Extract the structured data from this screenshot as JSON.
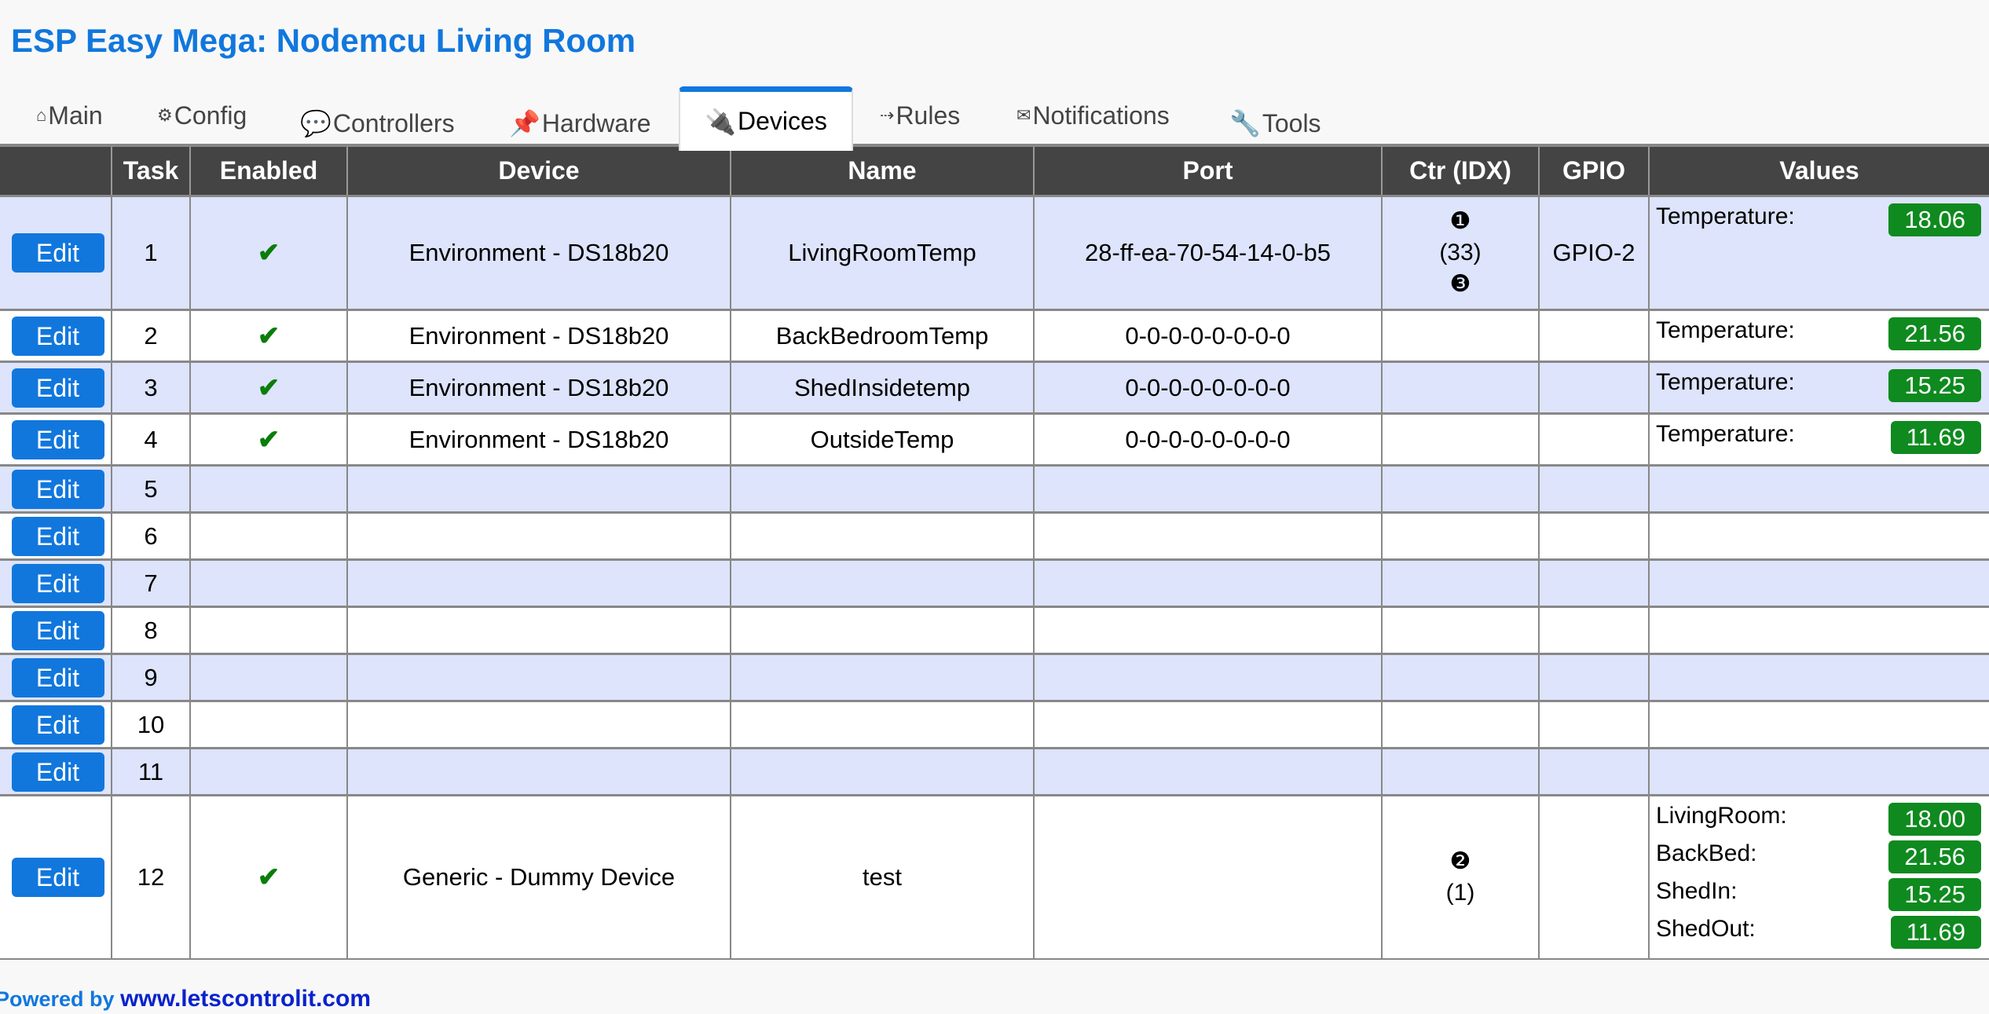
{
  "page_title": "ESP Easy Mega: Nodemcu Living Room",
  "tabs": [
    {
      "label": "Main",
      "icon": "⌂",
      "icon_name": "home-icon",
      "active": false
    },
    {
      "label": "Config",
      "icon": "⚙",
      "icon_name": "gear-icon",
      "active": false
    },
    {
      "label": "Controllers",
      "icon": "💬",
      "icon_name": "speech-bubble-icon",
      "active": false
    },
    {
      "label": "Hardware",
      "icon": "📌",
      "icon_name": "pushpin-icon",
      "active": false
    },
    {
      "label": "Devices",
      "icon": "🔌",
      "icon_name": "plug-icon",
      "active": true
    },
    {
      "label": "Rules",
      "icon": "⇢",
      "icon_name": "arrow-right-icon",
      "active": false
    },
    {
      "label": "Notifications",
      "icon": "✉",
      "icon_name": "envelope-icon",
      "active": false
    },
    {
      "label": "Tools",
      "icon": "🔧",
      "icon_name": "wrench-icon",
      "active": false
    }
  ],
  "table": {
    "headers": [
      "",
      "Task",
      "Enabled",
      "Device",
      "Name",
      "Port",
      "Ctr (IDX)",
      "GPIO",
      "Values"
    ],
    "edit_label": "Edit",
    "enabled_mark": "✔",
    "rows": [
      {
        "task": "1",
        "enabled": true,
        "device": "Environment - DS18b20",
        "name": "LivingRoomTemp",
        "port": "28-ff-ea-70-54-14-0-b5",
        "ctr": [
          "❶",
          "(33)",
          "❸"
        ],
        "gpio": "GPIO-2",
        "values": [
          {
            "label": "Temperature:",
            "value": "18.06"
          }
        ]
      },
      {
        "task": "2",
        "enabled": true,
        "device": "Environment - DS18b20",
        "name": "BackBedroomTemp",
        "port": "0-0-0-0-0-0-0-0",
        "ctr": [],
        "gpio": "",
        "values": [
          {
            "label": "Temperature:",
            "value": "21.56"
          }
        ]
      },
      {
        "task": "3",
        "enabled": true,
        "device": "Environment - DS18b20",
        "name": "ShedInsidetemp",
        "port": "0-0-0-0-0-0-0-0",
        "ctr": [],
        "gpio": "",
        "values": [
          {
            "label": "Temperature:",
            "value": "15.25"
          }
        ]
      },
      {
        "task": "4",
        "enabled": true,
        "device": "Environment - DS18b20",
        "name": "OutsideTemp",
        "port": "0-0-0-0-0-0-0-0",
        "ctr": [],
        "gpio": "",
        "values": [
          {
            "label": "Temperature:",
            "value": "11.69"
          }
        ]
      },
      {
        "task": "5",
        "enabled": false,
        "device": "",
        "name": "",
        "port": "",
        "ctr": [],
        "gpio": "",
        "values": []
      },
      {
        "task": "6",
        "enabled": false,
        "device": "",
        "name": "",
        "port": "",
        "ctr": [],
        "gpio": "",
        "values": []
      },
      {
        "task": "7",
        "enabled": false,
        "device": "",
        "name": "",
        "port": "",
        "ctr": [],
        "gpio": "",
        "values": []
      },
      {
        "task": "8",
        "enabled": false,
        "device": "",
        "name": "",
        "port": "",
        "ctr": [],
        "gpio": "",
        "values": []
      },
      {
        "task": "9",
        "enabled": false,
        "device": "",
        "name": "",
        "port": "",
        "ctr": [],
        "gpio": "",
        "values": []
      },
      {
        "task": "10",
        "enabled": false,
        "device": "",
        "name": "",
        "port": "",
        "ctr": [],
        "gpio": "",
        "values": []
      },
      {
        "task": "11",
        "enabled": false,
        "device": "",
        "name": "",
        "port": "",
        "ctr": [],
        "gpio": "",
        "values": []
      },
      {
        "task": "12",
        "enabled": true,
        "device": "Generic - Dummy Device",
        "name": "test",
        "port": "",
        "ctr": [
          "❷",
          "(1)"
        ],
        "gpio": "",
        "values": [
          {
            "label": "LivingRoom:",
            "value": "18.00"
          },
          {
            "label": "BackBed:",
            "value": "21.56"
          },
          {
            "label": "ShedIn:",
            "value": "15.25"
          },
          {
            "label": "ShedOut:",
            "value": "11.69"
          }
        ]
      }
    ]
  },
  "footer": {
    "powered_by": "Powered by",
    "link_text": "www.letscontrolit.com"
  },
  "colors": {
    "accent": "#1177dd",
    "header_bg": "#444444",
    "row_alt": "#dde4fb",
    "value_badge": "#0f8a1f",
    "check": "#0a7d0a"
  }
}
